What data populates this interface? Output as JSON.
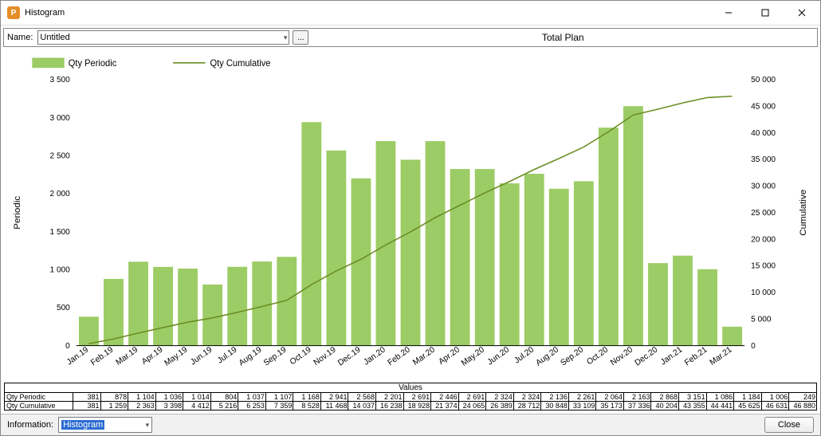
{
  "window": {
    "title": "Histogram"
  },
  "toolbar": {
    "name_label": "Name:",
    "name_value": "Untitled",
    "plan_title": "Total Plan",
    "dots": "..."
  },
  "legend": {
    "periodic": "Qty Periodic",
    "cumulative": "Qty Cumulative"
  },
  "axes": {
    "left_label": "Periodic",
    "right_label": "Cumulative",
    "values_caption": "Values"
  },
  "table": {
    "row1": "Qty Periodic",
    "row2": "Qty Cumulative"
  },
  "footer": {
    "info_label": "Information:",
    "info_value": "Histogram",
    "close": "Close"
  },
  "left_ticks": [
    "0",
    "500",
    "1 000",
    "1 500",
    "2 000",
    "2 500",
    "3 000",
    "3 500"
  ],
  "right_ticks": [
    "0",
    "5 000",
    "10 000",
    "15 000",
    "20 000",
    "25 000",
    "30 000",
    "35 000",
    "40 000",
    "45 000",
    "50 000"
  ],
  "chart_data": {
    "type": "bar+line",
    "title": "Total Plan",
    "xlabel": "",
    "ylabel_left": "Periodic",
    "ylabel_right": "Cumulative",
    "ylim_left": [
      0,
      3500
    ],
    "ylim_right": [
      0,
      50000
    ],
    "categories": [
      "Jan.19",
      "Feb.19",
      "Mar.19",
      "Apr.19",
      "May.19",
      "Jun.19",
      "Jul.19",
      "Aug.19",
      "Sep.19",
      "Oct.19",
      "Nov.19",
      "Dec.19",
      "Jan.20",
      "Feb.20",
      "Mar.20",
      "Apr.20",
      "May.20",
      "Jun.20",
      "Jul.20",
      "Aug.20",
      "Sep.20",
      "Oct.20",
      "Nov.20",
      "Dec.20",
      "Jan.21",
      "Feb.21",
      "Mar.21"
    ],
    "series": [
      {
        "name": "Qty Periodic",
        "kind": "bar",
        "axis": "left",
        "values": [
          381,
          878,
          1104,
          1036,
          1014,
          804,
          1037,
          1107,
          1168,
          2941,
          2568,
          2201,
          2691,
          2446,
          2691,
          2324,
          2324,
          2136,
          2261,
          2064,
          2163,
          2868,
          3151,
          1086,
          1184,
          1006,
          249
        ],
        "labels": [
          "381",
          "878",
          "1 104",
          "1 036",
          "1 014",
          "804",
          "1 037",
          "1 107",
          "1 168",
          "2 941",
          "2 568",
          "2 201",
          "2 691",
          "2 446",
          "2 691",
          "2 324",
          "2 324",
          "2 136",
          "2 261",
          "2 064",
          "2 163",
          "2 868",
          "3 151",
          "1 086",
          "1 184",
          "1 006",
          "249"
        ]
      },
      {
        "name": "Qty Cumulative",
        "kind": "line",
        "axis": "right",
        "values": [
          381,
          1259,
          2363,
          3398,
          4412,
          5216,
          6253,
          7359,
          8528,
          11468,
          14037,
          16238,
          18928,
          21374,
          24065,
          26389,
          28712,
          30848,
          33109,
          35173,
          37336,
          40204,
          43355,
          44441,
          45625,
          46631,
          46880
        ],
        "labels": [
          "381",
          "1 259",
          "2 363",
          "3 398",
          "4 412",
          "5 216",
          "6 253",
          "7 359",
          "8 528",
          "11 468",
          "14 037",
          "16 238",
          "18 928",
          "21 374",
          "24 065",
          "26 389",
          "28 712",
          "30 848",
          "33 109",
          "35 173",
          "37 336",
          "40 204",
          "43 355",
          "44 441",
          "45 625",
          "46 631",
          "46 880"
        ]
      }
    ]
  }
}
